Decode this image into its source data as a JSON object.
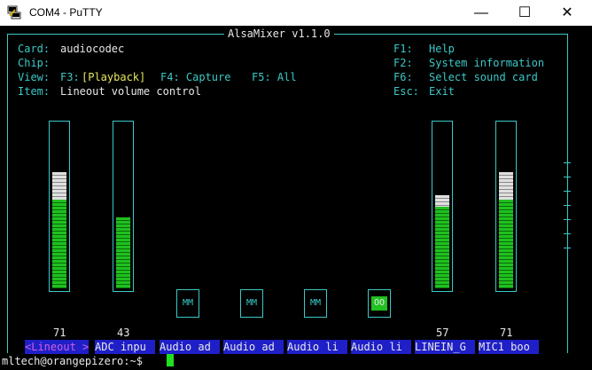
{
  "window": {
    "title": "COM4 - PuTTY",
    "minimize": "—",
    "maximize": "☐",
    "close": "✕"
  },
  "mixer": {
    "header": "AlsaMixer v1.1.0",
    "card_label": "Card:",
    "card_value": "audiocodec",
    "chip_label": "Chip:",
    "chip_value": "",
    "view_label": "View:",
    "view_f3": "F3:",
    "view_playback": "[Playback]",
    "view_f4": "F4: Capture",
    "view_f5": "F5: All",
    "item_label": "Item:",
    "item_value": "Lineout volume control",
    "keys": [
      {
        "key": "F1:",
        "desc": "Help"
      },
      {
        "key": "F2:",
        "desc": "System information"
      },
      {
        "key": "F6:",
        "desc": "Select sound card"
      },
      {
        "key": "Esc:",
        "desc": "Exit"
      }
    ]
  },
  "controls": [
    {
      "label": "<Lineout >",
      "value": "71",
      "level": 0.71,
      "gray": 0.17,
      "type": "volume"
    },
    {
      "label": "ADC inpu",
      "value": "43",
      "level": 0.43,
      "gray": 0,
      "type": "volume"
    },
    {
      "label": "Audio ad",
      "value": "",
      "type": "switch",
      "state": "MM"
    },
    {
      "label": "Audio ad",
      "value": "",
      "type": "switch",
      "state": "MM"
    },
    {
      "label": "Audio li",
      "value": "",
      "type": "switch",
      "state": "MM"
    },
    {
      "label": "Audio li",
      "value": "",
      "type": "switch",
      "state": "OO"
    },
    {
      "label": "LINEIN_G",
      "value": "57",
      "level": 0.57,
      "gray": 0.07,
      "type": "volume"
    },
    {
      "label": "MIC1 boo",
      "value": "71",
      "level": 0.71,
      "gray": 0.17,
      "type": "volume"
    }
  ],
  "prompt": "mltech@orangepizero:~$ ",
  "colors": {
    "green": "#20c020",
    "gray": "#e0e0e0",
    "cyan": "#3cc8c8",
    "blue": "#1f1fc8"
  }
}
